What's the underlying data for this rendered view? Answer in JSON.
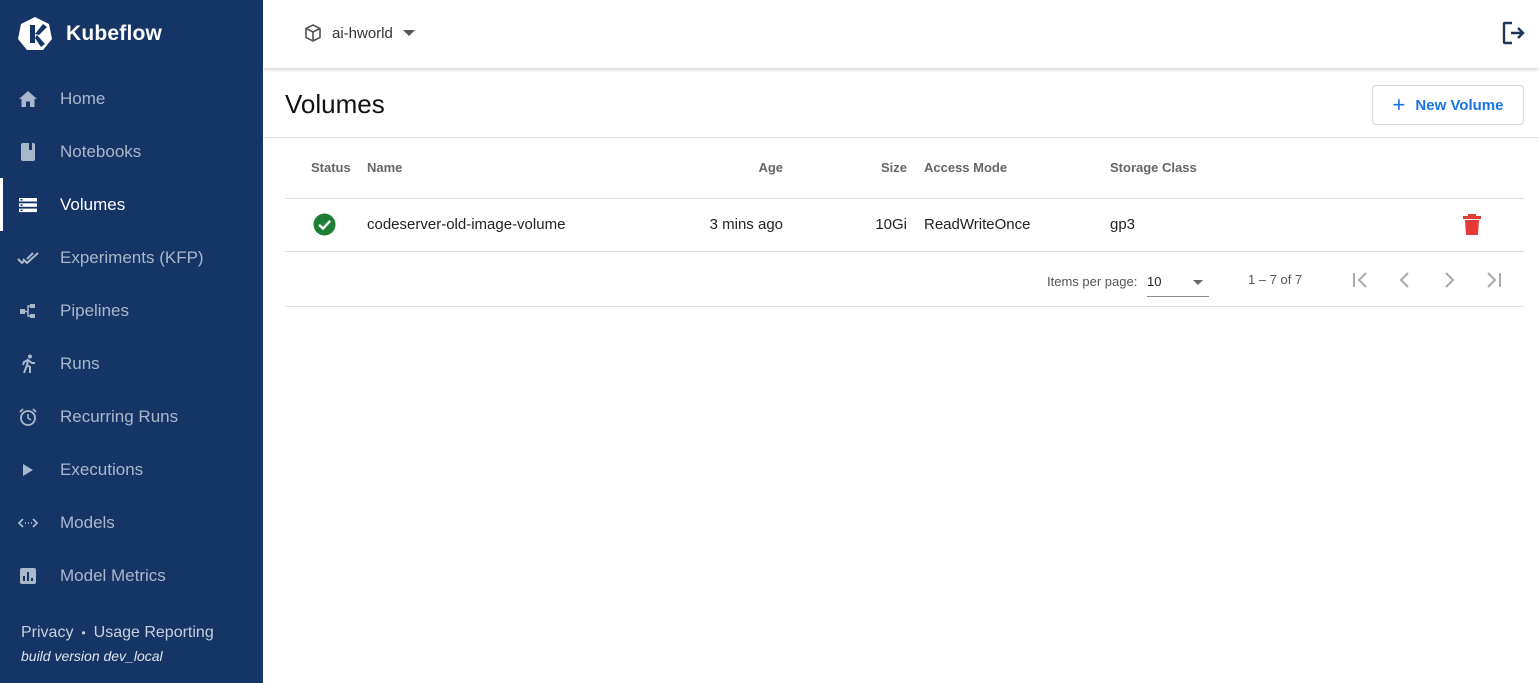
{
  "brand": {
    "name": "Kubeflow"
  },
  "sidebar": {
    "items": [
      {
        "label": "Home",
        "icon": "home-icon"
      },
      {
        "label": "Notebooks",
        "icon": "notebook-icon"
      },
      {
        "label": "Volumes",
        "icon": "storage-icon",
        "active": true
      },
      {
        "label": "Experiments (KFP)",
        "icon": "done-all-icon"
      },
      {
        "label": "Pipelines",
        "icon": "pipeline-icon"
      },
      {
        "label": "Runs",
        "icon": "run-icon"
      },
      {
        "label": "Recurring Runs",
        "icon": "alarm-icon"
      },
      {
        "label": "Executions",
        "icon": "play-icon"
      },
      {
        "label": "Models",
        "icon": "code-arrows-icon"
      },
      {
        "label": "Model Metrics",
        "icon": "bar-chart-icon"
      }
    ],
    "footer": {
      "privacy": "Privacy",
      "separator": "•",
      "usage": "Usage Reporting",
      "build": "build version dev_local"
    }
  },
  "topbar": {
    "namespace": "ai-hworld"
  },
  "page": {
    "title": "Volumes",
    "new_button": "New Volume",
    "new_button_icon": "+"
  },
  "table": {
    "headers": {
      "status": "Status",
      "name": "Name",
      "age": "Age",
      "size": "Size",
      "access_mode": "Access Mode",
      "storage_class": "Storage Class"
    },
    "rows": [
      {
        "status": "ready",
        "name": "codeserver-old-image-volume",
        "age": "3 mins ago",
        "size": "10Gi",
        "access_mode": "ReadWriteOnce",
        "storage_class": "gp3"
      }
    ]
  },
  "pagination": {
    "items_per_page_label": "Items per page:",
    "items_per_page": "10",
    "range": "1 – 7 of 7"
  },
  "colors": {
    "sidebar_bg": "#143565",
    "accent": "#1a73e8",
    "status_ok": "#1e7e34",
    "delete": "#e53935"
  }
}
